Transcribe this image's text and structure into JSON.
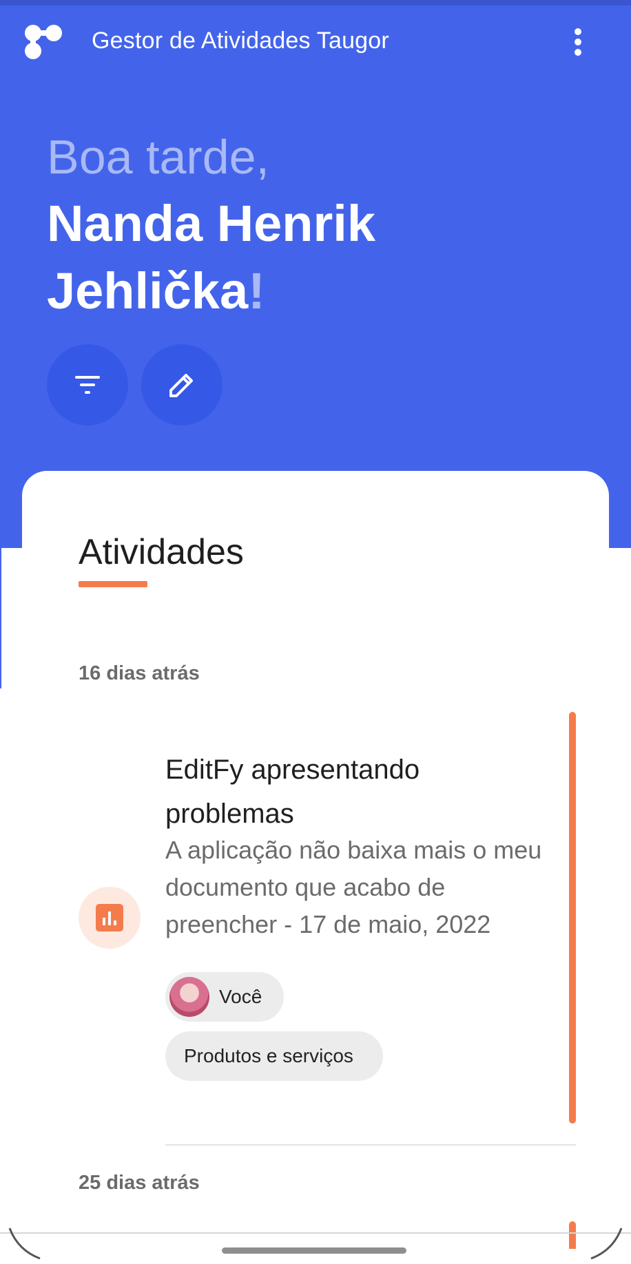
{
  "app": {
    "title": "Gestor de Atividades Taugor"
  },
  "header": {
    "greeting": "Boa tarde,",
    "user_name": "Nanda Henrik Jehlička",
    "exclamation": "!"
  },
  "actions": {
    "filter_icon": "filter-icon",
    "edit_icon": "pencil-icon"
  },
  "section": {
    "title": "Atividades"
  },
  "groups": [
    {
      "date_label": "16 dias atrás",
      "card": {
        "title": "EditFy apresentando problemas",
        "description": "A aplicação não baixa mais o meu documento que acabo de preencher - 17 de maio, 2022",
        "assignee": "Você",
        "category": "Produtos e serviços",
        "category_icon": "bar-chart-icon"
      }
    },
    {
      "date_label": "25 dias atrás"
    }
  ],
  "colors": {
    "primary": "#4364ea",
    "accent": "#f47c4c",
    "button": "#3558e7"
  }
}
